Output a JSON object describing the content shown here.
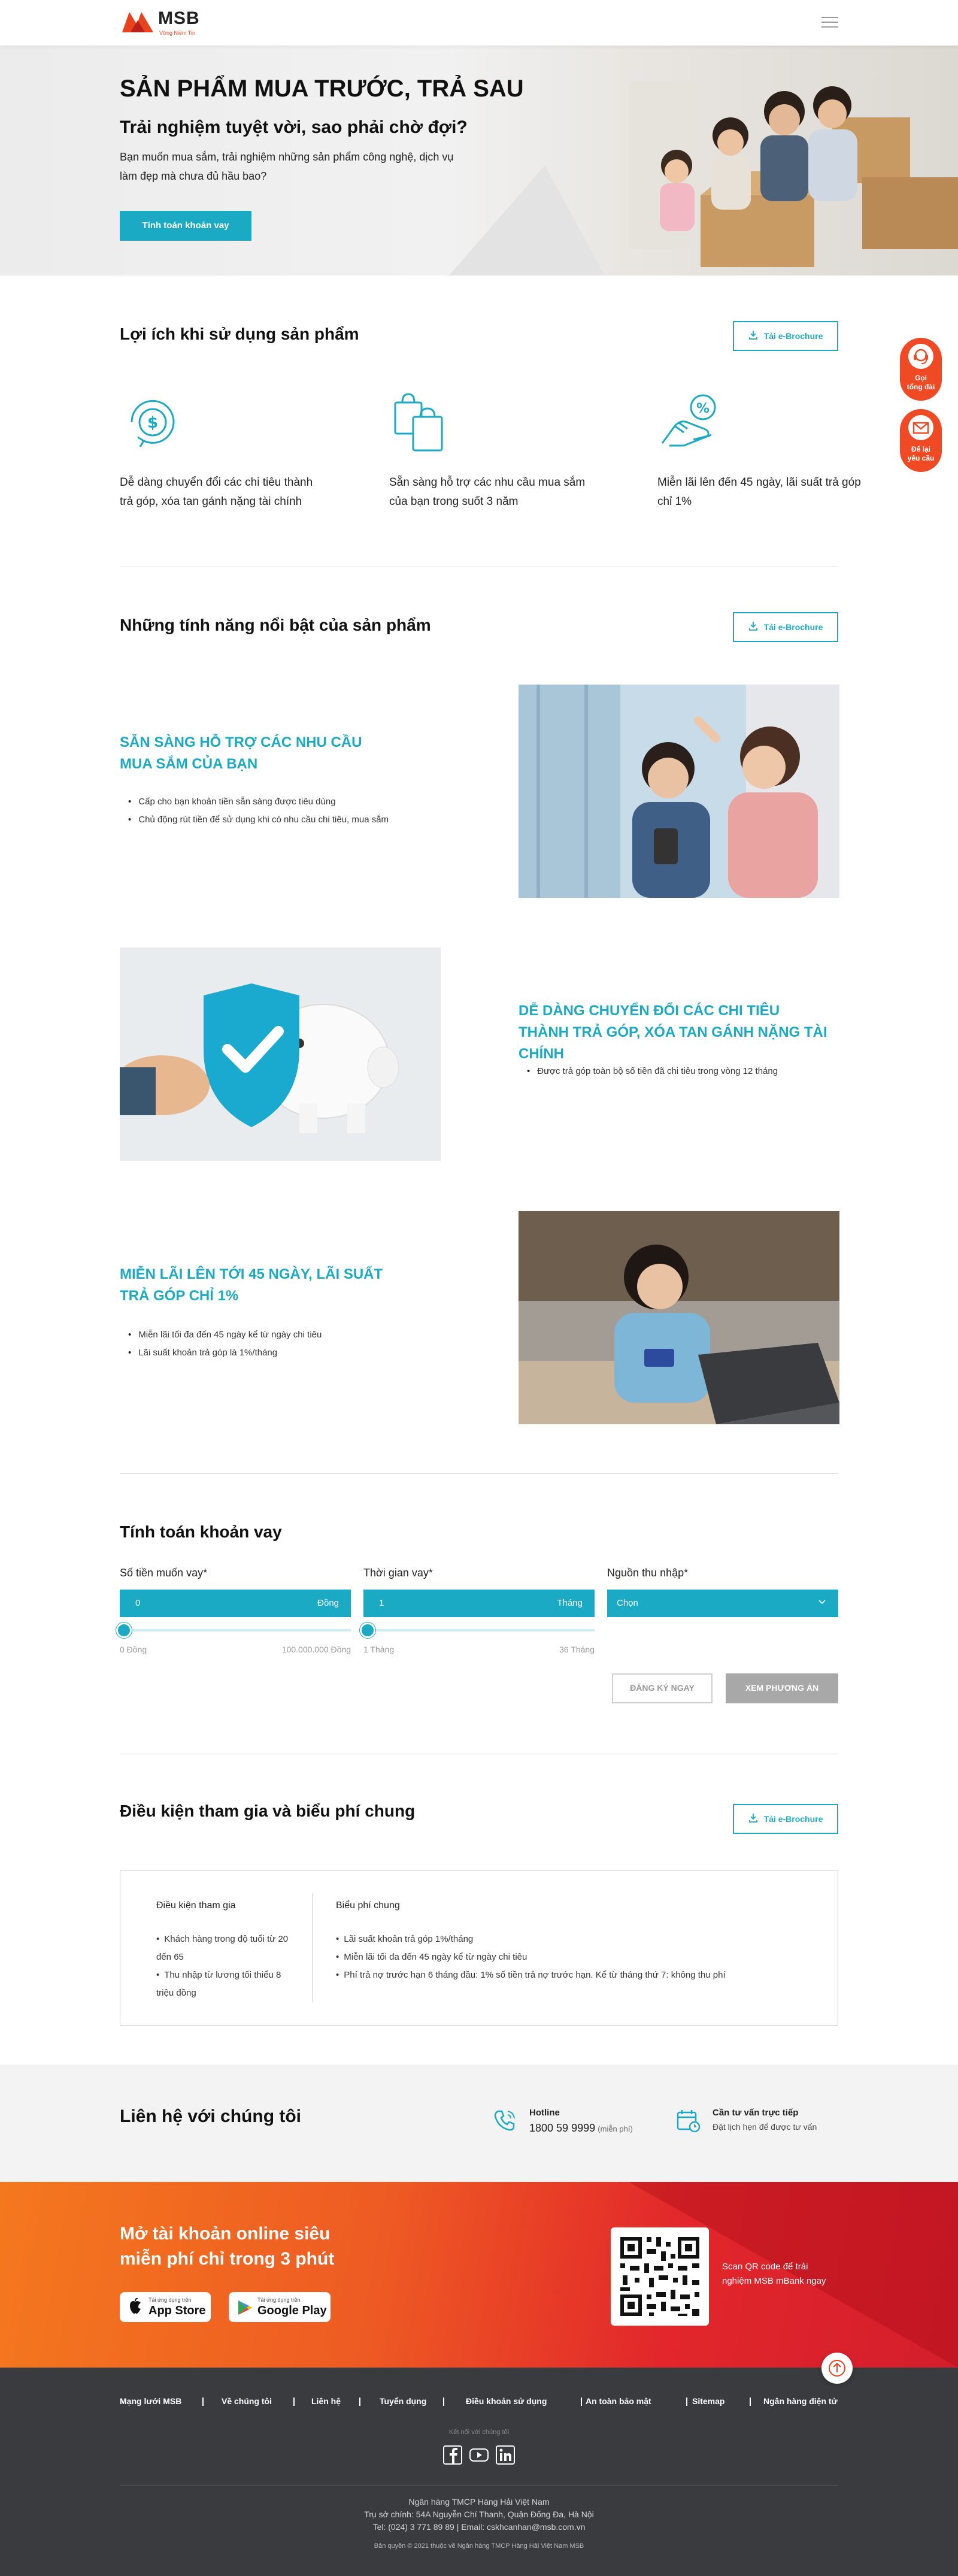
{
  "header": {
    "brand": "MSB",
    "tagline": "Vững Niềm Tin"
  },
  "hero": {
    "title": "SẢN PHẨM MUA TRƯỚC, TRẢ SAU",
    "subtitle": "Trải nghiệm tuyệt vời, sao phải chờ đợi?",
    "desc": "Bạn muốn mua sắm, trải nghiệm những sản phẩm công nghệ, dịch vụ làm đẹp mà chưa đủ hầu bao?",
    "cta": "Tính toán khoản vay"
  },
  "floating": {
    "call": [
      "Gọi",
      "tổng đài"
    ],
    "contact": [
      "Để lại",
      "yêu cầu"
    ]
  },
  "benefits": {
    "title": "Lợi ích khi sử dụng sản phẩm",
    "brochure": "Tải e-Brochure",
    "items": [
      {
        "icon": "dollar-cycle-icon",
        "text": "Dễ dàng chuyển đổi các chi tiêu thành trả góp, xóa tan gánh nặng tài chính"
      },
      {
        "icon": "shopping-bags-icon",
        "text": "Sẵn sàng hỗ trợ các nhu cầu mua sắm của bạn trong suốt 3 năm"
      },
      {
        "icon": "percent-hand-icon",
        "text": "Miễn lãi lên đến 45 ngày, lãi suất trả góp chỉ 1%"
      }
    ]
  },
  "features": {
    "title": "Những tính năng nổi bật của sản phẩm",
    "brochure": "Tải e-Brochure",
    "items": [
      {
        "title": "SẴN SÀNG HỖ TRỢ CÁC NHU CẦU MUA SẮM CỦA BẠN",
        "bullets": [
          "Cấp cho bạn khoản tiền sẵn sàng được tiêu dùng",
          "Chủ động rút tiền để sử dụng khi có nhu cầu chi tiêu, mua sắm"
        ]
      },
      {
        "title": "DỄ DÀNG CHUYỂN ĐỔI CÁC CHI TIÊU THÀNH TRẢ GÓP, XÓA TAN GÁNH NẶNG TÀI CHÍNH",
        "bullets": [
          "Được trả góp toàn bộ số tiền đã chi tiêu trong vòng 12 tháng"
        ]
      },
      {
        "title": "MIỄN LÃI LÊN TỚI 45 NGÀY, LÃI SUẤT TRẢ GÓP CHỈ 1%",
        "bullets": [
          "Miễn lãi tối đa đến 45 ngày kể từ ngày chi tiêu",
          "Lãi suất khoản trả góp là 1%/tháng"
        ]
      }
    ]
  },
  "calculator": {
    "title": "Tính toán khoản vay",
    "amount": {
      "label": "Số tiền muốn vay*",
      "value": "0",
      "unit": "Đồng",
      "min": "0 Đồng",
      "max": "100.000.000 Đồng",
      "level": 0
    },
    "term": {
      "label": "Thời gian vay*",
      "value": "1",
      "unit": "Tháng",
      "min": "1 Tháng",
      "max": "36 Tháng",
      "level": 0
    },
    "income": {
      "label": "Nguồn thu nhập*",
      "value": "Chọn"
    },
    "register": "ĐĂNG KÝ NGAY",
    "view": "XEM PHƯƠNG ÁN"
  },
  "conditions": {
    "title": "Điều kiện tham gia và biểu phí chung",
    "brochure": "Tải e-Brochure",
    "left_title": "Điều kiện tham gia",
    "left_items": [
      "Khách hàng trong độ tuổi từ 20 đến 65",
      "Thu nhập từ lương tối thiểu 8 triệu đồng"
    ],
    "right_title": "Biểu phí chung",
    "right_items": [
      "Lãi suất khoản trả góp 1%/tháng",
      "Miễn lãi tối đa đến 45 ngày kể từ ngày chi tiêu",
      "Phí trả nợ trước hạn 6 tháng đầu: 1% số tiền trả nợ trước hạn. Kể từ tháng thứ 7: không thu phí"
    ]
  },
  "contact": {
    "title": "Liên hệ với chúng tôi",
    "hotline_label": "Hotline",
    "hotline": "1800 59 9999",
    "hotline_note": "(miễn phí)",
    "advise_title": "Cần tư vấn trực tiếp",
    "advise_sub": "Đặt lịch hẹn để được tư vấn"
  },
  "promo": {
    "title": "Mở tài khoản online siêu miễn phí chỉ trong 3 phút",
    "appstore_small": "Tải ứng dụng trên",
    "appstore": "App Store",
    "googleplay_small": "Tải ứng dụng trên",
    "googleplay": "Google Play",
    "qr_text": "Scan QR code để trải nghiệm MSB mBank ngay"
  },
  "footer": {
    "nav": [
      "Mạng lưới MSB",
      "Về chúng tôi",
      "Liên hệ",
      "Tuyển dụng",
      "Điều khoản sử dụng",
      "An toàn bảo mật",
      "Sitemap",
      "Ngân hàng điện tử"
    ],
    "connect": "Kết nối với chúng tôi",
    "bank": "Ngân hàng TMCP Hàng Hải Việt Nam",
    "address": "Trụ sở chính: 54A Nguyễn Chí Thanh, Quận Đống Đa, Hà Nội",
    "phone": "Tel: (024) 3 771 89 89 | Email: cskhcanhan@msb.com.vn",
    "copyright": "Bản quyền © 2021 thuộc về Ngân hàng TMCP Hàng Hải Việt Nam MSB"
  },
  "colors": {
    "accent": "#1aaac4",
    "brand_red": "#e8431e",
    "footer": "#3a3b3f"
  }
}
